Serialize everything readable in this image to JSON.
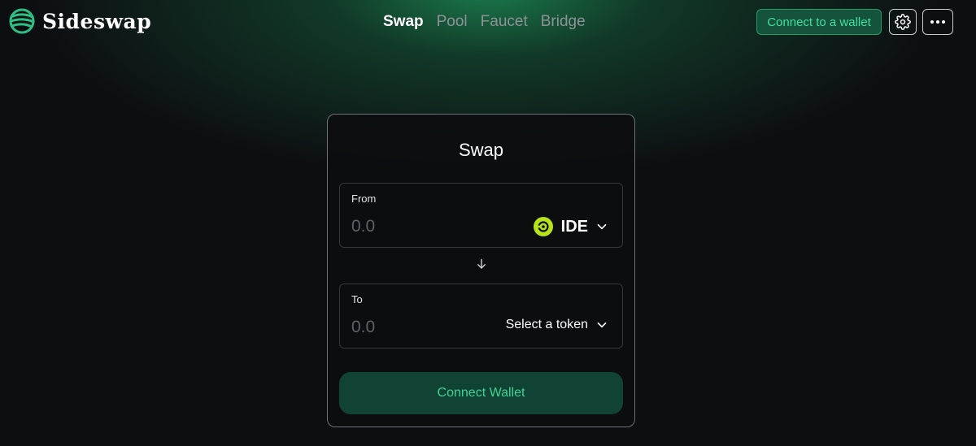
{
  "brand": {
    "name": "Sideswap",
    "logo_icon": "globe-logo-icon",
    "accent_color": "#2bbf84"
  },
  "nav": {
    "items": [
      {
        "label": "Swap",
        "active": true
      },
      {
        "label": "Pool",
        "active": false
      },
      {
        "label": "Faucet",
        "active": false
      },
      {
        "label": "Bridge",
        "active": false
      }
    ]
  },
  "header": {
    "connect_label": "Connect to a wallet",
    "settings_icon": "gear-icon",
    "more_icon": "more-dots-icon"
  },
  "swap": {
    "title": "Swap",
    "from": {
      "label": "From",
      "amount_placeholder": "0.0",
      "token": "IDE",
      "token_icon": "ide-token-icon",
      "token_color": "#b7e31c"
    },
    "to": {
      "label": "To",
      "amount_placeholder": "0.0",
      "select_label": "Select a token"
    },
    "direction_icon": "arrow-down-icon",
    "connect_label": "Connect Wallet"
  }
}
